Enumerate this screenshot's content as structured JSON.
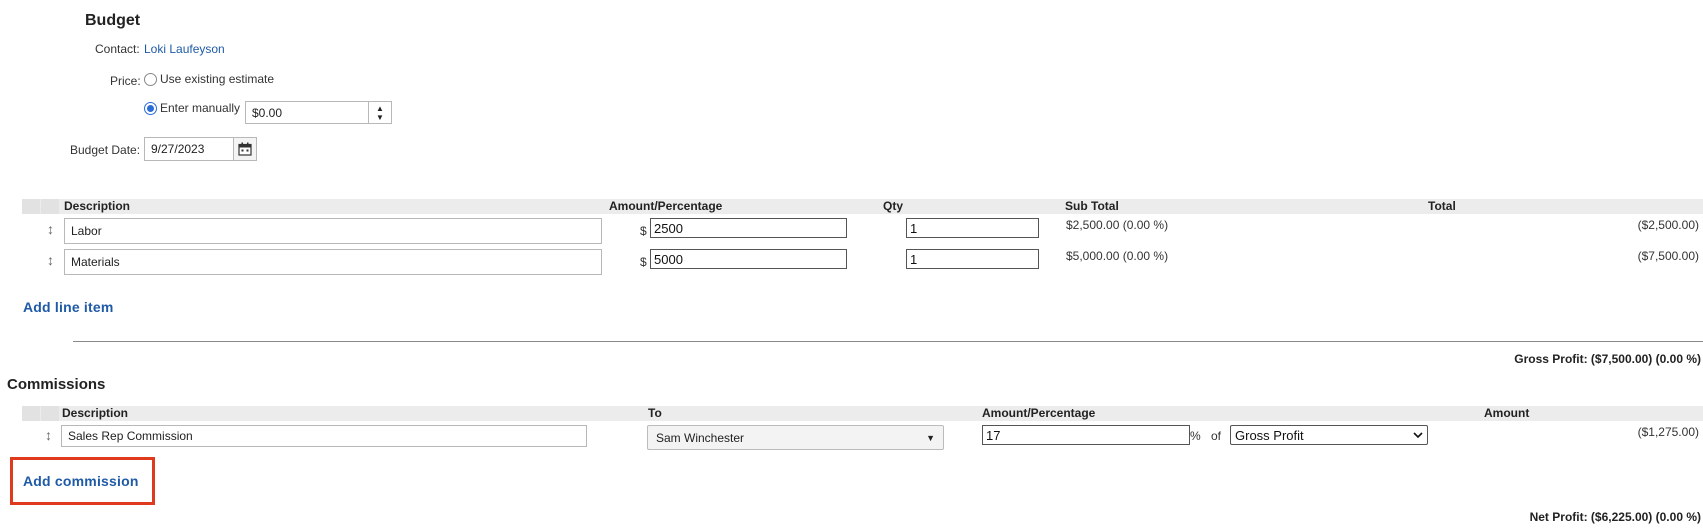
{
  "budget": {
    "title": "Budget",
    "contact_label": "Contact:",
    "contact_name": "Loki Laufeyson",
    "price_label": "Price:",
    "option_existing": "Use existing estimate",
    "option_manual": "Enter manually",
    "manual_value": "$0.00",
    "date_label": "Budget Date:",
    "date_value": "9/27/2023"
  },
  "line_items": {
    "headers": {
      "description": "Description",
      "amount": "Amount/Percentage",
      "qty": "Qty",
      "subtotal": "Sub Total",
      "total": "Total"
    },
    "rows": [
      {
        "description": "Labor",
        "currency": "$",
        "amount": "2500",
        "qty": "1",
        "subtotal": "$2,500.00 (0.00 %)",
        "total": "($2,500.00)"
      },
      {
        "description": "Materials",
        "currency": "$",
        "amount": "5000",
        "qty": "1",
        "subtotal": "$5,000.00 (0.00 %)",
        "total": "($7,500.00)"
      }
    ],
    "add_label": "Add line item",
    "gross_profit": "Gross Profit: ($7,500.00) (0.00 %)"
  },
  "commissions": {
    "title": "Commissions",
    "headers": {
      "description": "Description",
      "to": "To",
      "amount": "Amount/Percentage",
      "amount_col": "Amount"
    },
    "rows": [
      {
        "description": "Sales Rep Commission",
        "to": "Sam Winchester",
        "percentage": "17",
        "percent_sign": "%",
        "of_label": "of",
        "basis": "Gross Profit",
        "amount": "($1,275.00)"
      }
    ],
    "add_label": "Add commission",
    "net_profit": "Net Profit: ($6,225.00) (0.00 %)"
  },
  "colors": {
    "link": "#1f5aa6",
    "highlight": "#e03a1e",
    "header_bar": "#ececec"
  }
}
